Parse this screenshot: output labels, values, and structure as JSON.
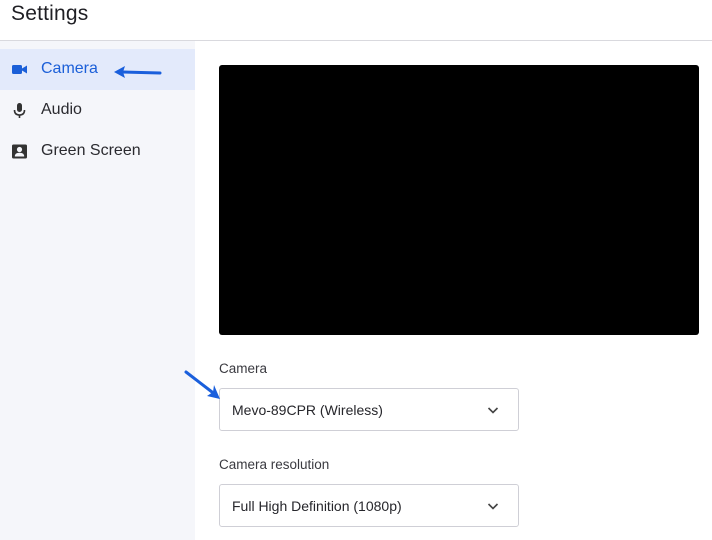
{
  "header": {
    "title": "Settings"
  },
  "sidebar": {
    "items": [
      {
        "label": "Camera",
        "icon": "video-camera-icon",
        "active": true
      },
      {
        "label": "Audio",
        "icon": "microphone-icon",
        "active": false
      },
      {
        "label": "Green Screen",
        "icon": "portrait-icon",
        "active": false
      }
    ]
  },
  "main": {
    "camera": {
      "label": "Camera",
      "value": "Mevo-89CPR (Wireless)"
    },
    "resolution": {
      "label": "Camera resolution",
      "value": "Full High Definition (1080p)"
    }
  },
  "colors": {
    "accent": "#1b5fd8",
    "active_bg": "#e3eafb",
    "sidebar_bg": "#f5f6fa",
    "annotation_arrow": "#1a5fdc"
  }
}
